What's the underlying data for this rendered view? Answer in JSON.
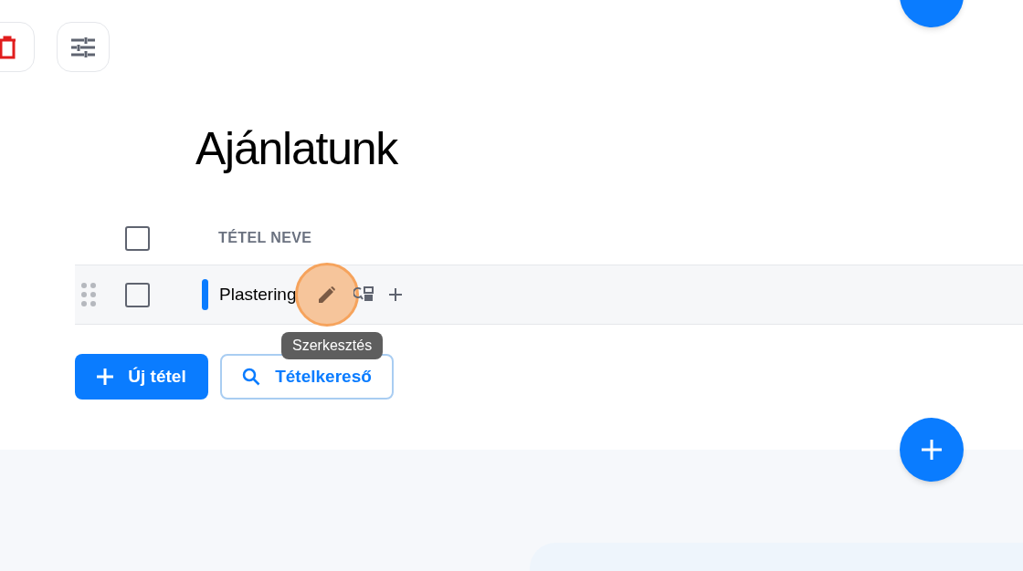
{
  "heading": "Ajánlatunk",
  "table": {
    "select_all": {
      "checked": false
    },
    "columns": [
      "TÉTEL NEVE"
    ],
    "rows": [
      {
        "name": "Plastering",
        "checked": false,
        "color": "#0a7cff"
      }
    ]
  },
  "tooltip": "Szerkesztés",
  "buttons": [
    {
      "kind": "primary",
      "label": "Új tétel"
    },
    {
      "kind": "outline",
      "label": "Tételkereső"
    }
  ]
}
